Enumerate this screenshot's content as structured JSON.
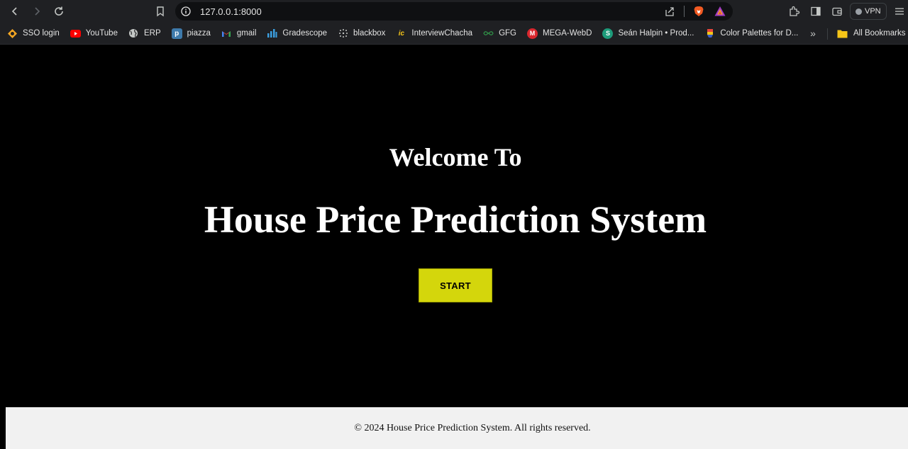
{
  "browser": {
    "url": "127.0.0.1:8000",
    "vpn_label": "VPN",
    "bookmarks": [
      {
        "label": "SSO login",
        "icon": "sso-icon"
      },
      {
        "label": "YouTube",
        "icon": "youtube-icon"
      },
      {
        "label": "ERP",
        "icon": "globe-icon"
      },
      {
        "label": "piazza",
        "icon": "piazza-icon"
      },
      {
        "label": "gmail",
        "icon": "gmail-icon"
      },
      {
        "label": "Gradescope",
        "icon": "gradescope-icon"
      },
      {
        "label": "blackbox",
        "icon": "blackbox-icon"
      },
      {
        "label": "InterviewChacha",
        "icon": "interviewchacha-icon"
      },
      {
        "label": "GFG",
        "icon": "gfg-icon"
      },
      {
        "label": "MEGA-WebD",
        "icon": "mega-icon"
      },
      {
        "label": "Seán Halpin • Prod...",
        "icon": "sean-halpin-icon"
      },
      {
        "label": "Color Palettes for D...",
        "icon": "color-palettes-icon"
      }
    ],
    "all_bookmarks_label": "All Bookmarks"
  },
  "page": {
    "welcome_text": "Welcome To",
    "title": "House Price Prediction System",
    "start_label": "START",
    "footer_text": "© 2024 House Price Prediction System. All rights reserved."
  },
  "colors": {
    "background": "#000000",
    "button": "#d4d60c",
    "footer_bg": "#f1f1f1",
    "text": "#ffffff"
  }
}
